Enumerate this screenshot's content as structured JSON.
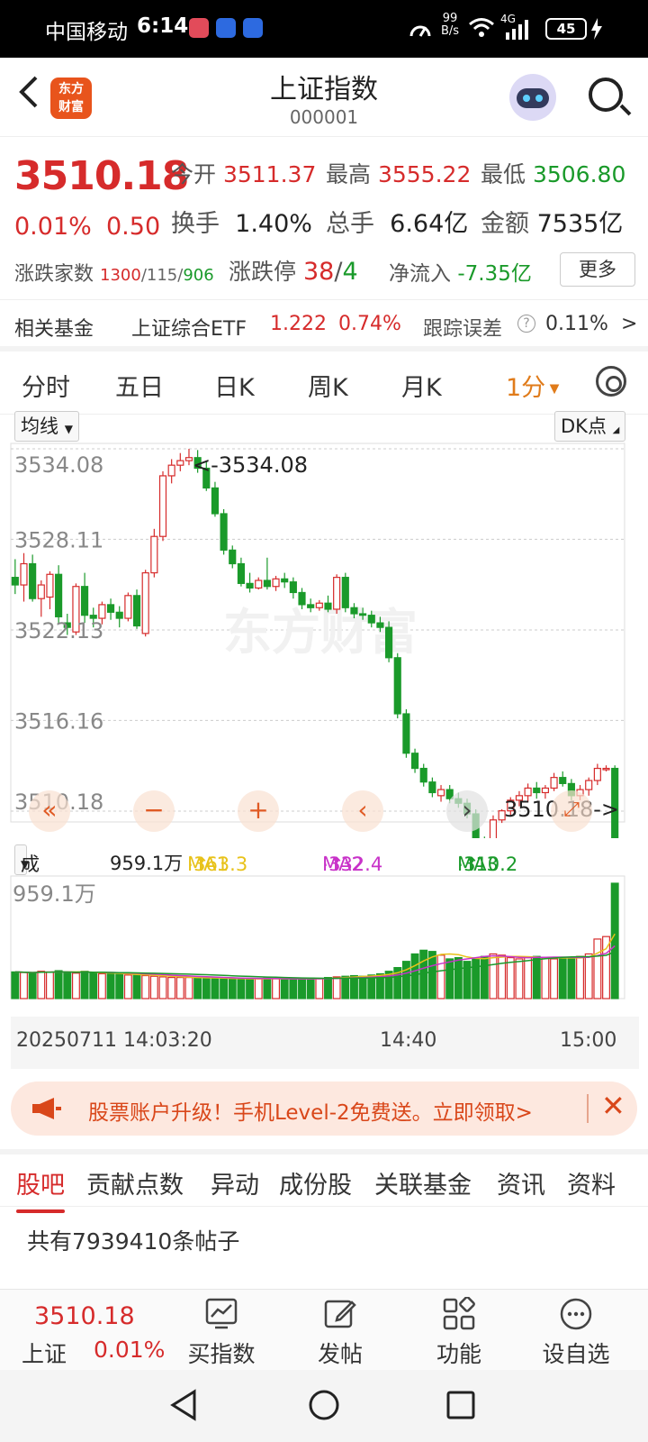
{
  "status_bar": {
    "carrier": "中国移动",
    "time": "6:14",
    "net_speed_top": "99",
    "net_speed_unit": "B/s",
    "signal_type": "4G",
    "battery": "45"
  },
  "header": {
    "logo_line1": "东方",
    "logo_line2": "财富",
    "title": "上证指数",
    "code": "000001"
  },
  "quote": {
    "price": "3510.18",
    "change_pct": "0.01%",
    "change": "0.50",
    "open_label": "今开",
    "open": "3511.37",
    "high_label": "最高",
    "high": "3555.22",
    "low_label": "最低",
    "low": "3506.80",
    "turnover_label": "换手",
    "turnover": "1.40%",
    "volume_label": "总手",
    "volume": "6.64亿",
    "amount_label": "金额",
    "amount": "7535亿",
    "adv_label": "涨跌家数",
    "adv_up": "1300",
    "adv_flat": "115",
    "adv_down": "906",
    "limit_label": "涨跌停",
    "limit_up": "38",
    "limit_down": "4",
    "inflow_label": "净流入",
    "inflow": "-7.35亿",
    "more": "更多"
  },
  "fund": {
    "label": "相关基金",
    "name": "上证综合ETF",
    "price": "1.222",
    "pct": "0.74%",
    "err_label": "跟踪误差",
    "err": "0.11%"
  },
  "periods": {
    "items": [
      "分时",
      "五日",
      "日K",
      "周K",
      "月K"
    ],
    "active": "1分"
  },
  "chart_controls": {
    "avg_line": "均线",
    "dk": "DK点",
    "volume_select": "成交量"
  },
  "chart_data": [
    {
      "type": "candlestick",
      "y_ticks": [
        "3534.08",
        "3528.11",
        "3522.13",
        "3516.16",
        "3510.18"
      ],
      "ylim": [
        3510.18,
        3534.08
      ],
      "max_marker": "<-3534.08",
      "last_marker": "3510.18->",
      "watermark": "东方财富",
      "candles": [
        [
          3525.6,
          3526.8,
          3524.5,
          3525.1
        ],
        [
          3525.1,
          3527.2,
          3524.0,
          3526.5
        ],
        [
          3526.5,
          3527.1,
          3524.0,
          3524.2
        ],
        [
          3524.2,
          3525.4,
          3523.0,
          3525.1
        ],
        [
          3524.3,
          3526.0,
          3523.5,
          3525.8
        ],
        [
          3525.8,
          3526.4,
          3522.6,
          3523.0
        ],
        [
          3522.6,
          3523.2,
          3521.8,
          3522.3
        ],
        [
          3522.0,
          3525.2,
          3521.8,
          3525.0
        ],
        [
          3525.0,
          3525.9,
          3522.6,
          3523.1
        ],
        [
          3523.1,
          3523.6,
          3522.3,
          3522.9
        ],
        [
          3522.9,
          3524.0,
          3522.5,
          3523.8
        ],
        [
          3523.8,
          3524.2,
          3522.8,
          3523.3
        ],
        [
          3523.3,
          3523.7,
          3522.3,
          3522.9
        ],
        [
          3522.9,
          3524.6,
          3522.7,
          3524.4
        ],
        [
          3524.4,
          3524.8,
          3522.2,
          3522.4
        ],
        [
          3521.9,
          3526.1,
          3521.7,
          3525.9
        ],
        [
          3525.9,
          3528.8,
          3525.6,
          3528.3
        ],
        [
          3528.3,
          3532.6,
          3528.0,
          3532.3
        ],
        [
          3532.3,
          3533.4,
          3531.8,
          3533.0
        ],
        [
          3533.0,
          3533.8,
          3532.6,
          3533.3
        ],
        [
          3533.3,
          3534.08,
          3533.0,
          3533.5
        ],
        [
          3533.5,
          3534.0,
          3532.5,
          3532.8
        ],
        [
          3532.8,
          3533.3,
          3531.3,
          3531.5
        ],
        [
          3531.5,
          3531.9,
          3529.6,
          3529.8
        ],
        [
          3529.8,
          3530.1,
          3527.1,
          3527.4
        ],
        [
          3527.4,
          3527.7,
          3526.2,
          3526.5
        ],
        [
          3526.5,
          3526.9,
          3525.0,
          3525.2
        ],
        [
          3525.2,
          3525.9,
          3524.6,
          3524.9
        ],
        [
          3524.9,
          3525.6,
          3524.8,
          3525.4
        ],
        [
          3525.4,
          3526.9,
          3524.8,
          3525.0
        ],
        [
          3525.0,
          3525.7,
          3524.7,
          3525.5
        ],
        [
          3525.5,
          3525.9,
          3524.9,
          3525.3
        ],
        [
          3525.3,
          3525.6,
          3524.2,
          3524.6
        ],
        [
          3524.6,
          3524.9,
          3523.5,
          3523.8
        ],
        [
          3523.8,
          3524.2,
          3523.3,
          3523.6
        ],
        [
          3523.6,
          3524.1,
          3523.4,
          3523.9
        ],
        [
          3523.9,
          3524.4,
          3523.3,
          3523.5
        ],
        [
          3523.5,
          3525.8,
          3523.2,
          3525.6
        ],
        [
          3525.6,
          3525.9,
          3523.3,
          3523.6
        ],
        [
          3523.6,
          3523.9,
          3522.9,
          3523.2
        ],
        [
          3523.2,
          3523.6,
          3522.8,
          3523.1
        ],
        [
          3523.1,
          3523.4,
          3522.3,
          3522.6
        ],
        [
          3522.6,
          3523.0,
          3522.0,
          3522.3
        ],
        [
          3522.3,
          3522.7,
          3520.0,
          3520.3
        ],
        [
          3520.3,
          3520.6,
          3516.3,
          3516.6
        ],
        [
          3516.6,
          3516.9,
          3513.7,
          3514.0
        ],
        [
          3514.0,
          3514.3,
          3512.7,
          3513.0
        ],
        [
          3513.0,
          3513.3,
          3511.8,
          3512.1
        ],
        [
          3512.1,
          3512.4,
          3511.1,
          3511.4
        ],
        [
          3511.2,
          3511.9,
          3510.8,
          3511.6
        ],
        [
          3511.6,
          3511.9,
          3510.7,
          3511.0
        ],
        [
          3511.0,
          3511.4,
          3510.4,
          3510.7
        ],
        [
          3510.7,
          3511.0,
          3509.7,
          3510.0
        ],
        [
          3510.0,
          3510.3,
          3508.0,
          3508.3
        ],
        [
          3508.3,
          3508.5,
          3505.5,
          3505.6
        ],
        [
          3505.5,
          3509.9,
          3505.3,
          3509.6
        ],
        [
          3509.6,
          3510.3,
          3509.4,
          3510.2
        ],
        [
          3510.2,
          3511.1,
          3509.9,
          3510.9
        ],
        [
          3510.9,
          3511.5,
          3510.5,
          3511.2
        ],
        [
          3511.2,
          3512.0,
          3510.8,
          3511.7
        ],
        [
          3511.7,
          3512.1,
          3511.0,
          3511.4
        ],
        [
          3511.4,
          3511.9,
          3511.0,
          3511.7
        ],
        [
          3511.7,
          3512.7,
          3511.5,
          3512.4
        ],
        [
          3512.4,
          3512.8,
          3511.8,
          3512.0
        ],
        [
          3512.0,
          3512.3,
          3510.9,
          3511.2
        ],
        [
          3511.2,
          3511.9,
          3510.9,
          3511.6
        ],
        [
          3511.6,
          3512.4,
          3511.2,
          3512.2
        ],
        [
          3512.2,
          3513.3,
          3511.9,
          3513.0
        ],
        [
          3513.0,
          3513.2,
          3512.8,
          3513.0
        ],
        [
          3513.0,
          3513.2,
          3505.8,
          3506.0
        ]
      ]
    },
    {
      "type": "bar",
      "label_max": "959.1万",
      "volume_max_wan": 959.1,
      "ma": [
        {
          "name": "MA1",
          "value": "363.3万",
          "arrow": "↑",
          "color": "#e8c21a"
        },
        {
          "name": "MA2",
          "value": "332.4万",
          "arrow": "↑",
          "color": "#c832c8"
        },
        {
          "name": "MA3",
          "value": "310.2万",
          "arrow": "↑",
          "color": "#1a9a2a"
        }
      ],
      "current_volume": "959.1万",
      "volumes": [
        215,
        210,
        205,
        220,
        215,
        225,
        210,
        205,
        220,
        205,
        200,
        200,
        195,
        190,
        190,
        185,
        180,
        175,
        170,
        170,
        170,
        165,
        165,
        165,
        160,
        160,
        155,
        160,
        160,
        165,
        160,
        155,
        160,
        160,
        165,
        160,
        170,
        175,
        180,
        185,
        180,
        190,
        200,
        220,
        250,
        300,
        360,
        390,
        380,
        350,
        320,
        330,
        300,
        320,
        340,
        360,
        350,
        330,
        320,
        330,
        340,
        330,
        320,
        320,
        330,
        340,
        360,
        480,
        500,
        930
      ],
      "x_ticks": [
        "20250711 14:03:20",
        "14:40",
        "15:00"
      ]
    }
  ],
  "banner": {
    "text": "股票账户升级！手机Level-2免费送。立即领取>"
  },
  "subtabs": {
    "items": [
      "股吧",
      "贡献点数",
      "异动",
      "成份股",
      "关联基金",
      "资讯",
      "资料"
    ],
    "active": 0
  },
  "posts": {
    "text": "共有7939410条帖子"
  },
  "bottom_nav": {
    "price": "3510.18",
    "name": "上证",
    "pct": "0.01%",
    "items": [
      "买指数",
      "发帖",
      "功能",
      "设自选"
    ]
  },
  "colors": {
    "up": "#d62b2b",
    "down": "#1a9a2a",
    "accent": "#e07b1a"
  }
}
